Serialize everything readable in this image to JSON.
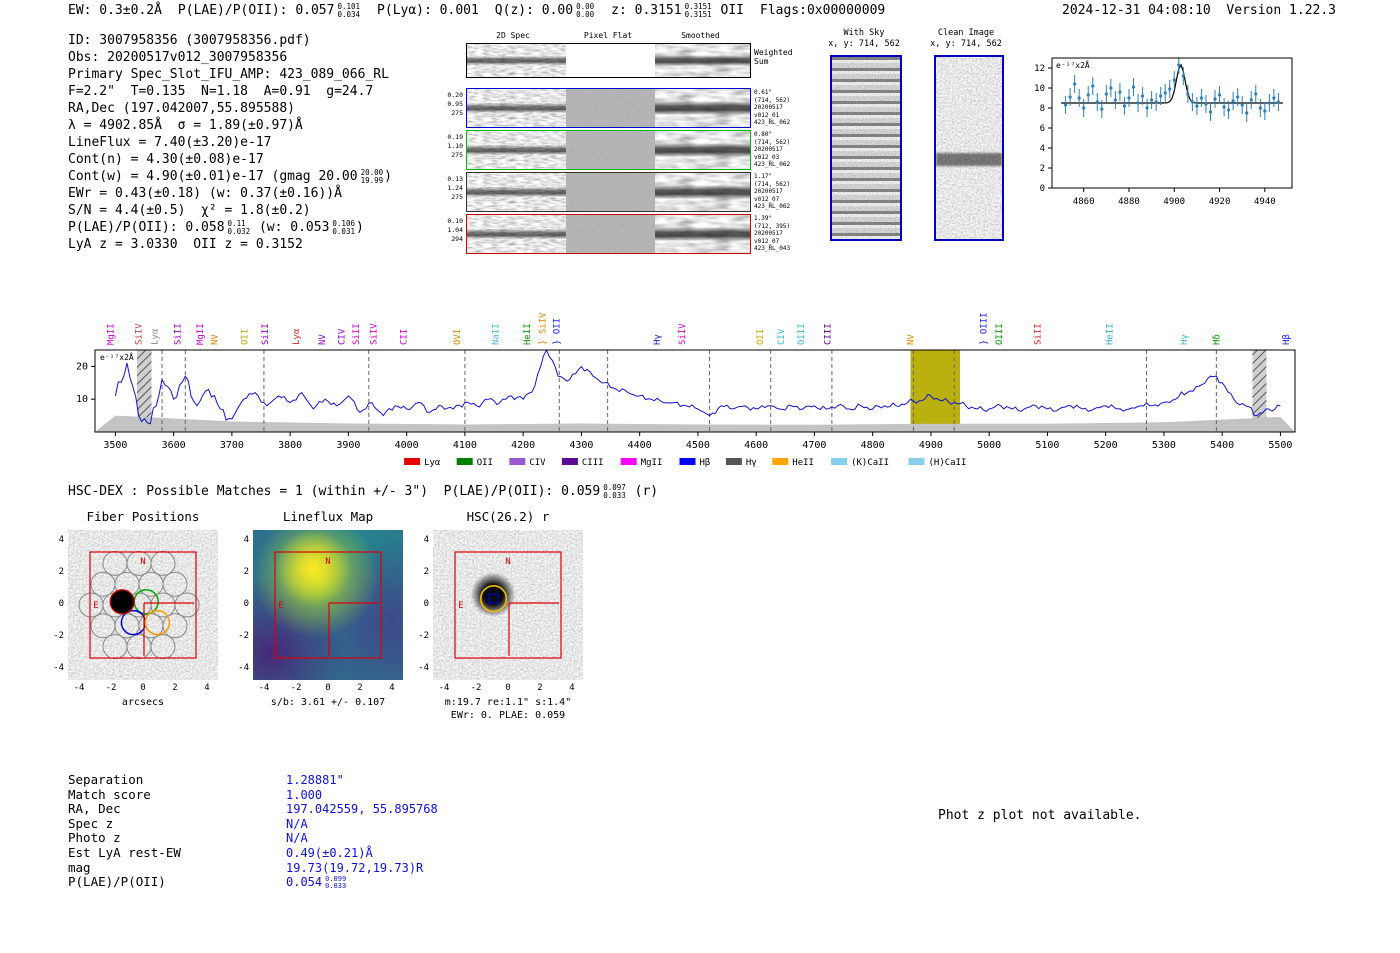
{
  "header": {
    "ew": "EW: 0.3±0.2Å",
    "plae": "P(LAE)/P(OII): 0.057",
    "plae_hi": "0.101",
    "plae_lo": "0.034",
    "plya": "P(Lyα): 0.001",
    "qz": "Q(z): 0.00",
    "qz_hi": "0.00",
    "qz_lo": "0.00",
    "z": "z: 0.3151",
    "z_hi": "0.3151",
    "z_lo": "0.3151",
    "z_type": "OII",
    "flags": "Flags:0x00000009",
    "datetime": "2024-12-31 04:08:10",
    "version": "Version 1.22.3"
  },
  "info": {
    "id": "ID: 3007958356 (3007958356.pdf)",
    "obs": "Obs: 20200517v012_3007958356",
    "primary": "Primary Spec_Slot_IFU_AMP: 423_089_066_RL",
    "seeing": "F=2.2\"  T=0.135  N=1.18  A=0.91  g=24.7",
    "radec": "RA,Dec (197.042007,55.895588)",
    "lambda": "λ = 4902.85Å  σ = 1.89(±0.97)Å",
    "lineflux": "LineFlux = 7.40(±3.20)e-17",
    "cont_n": "Cont(n) = 4.30(±0.08)e-17",
    "cont_w": "Cont(w) = 4.90(±0.01)e-17 (gmag 20.00",
    "cont_w_hi": "20.00",
    "cont_w_lo": "19.99",
    "cont_w_end": ")",
    "ewr": "EWr = 0.43(±0.18) (w: 0.37(±0.16))Å",
    "sn": "S/N = 4.4(±0.5)  χ² = 1.8(±0.2)",
    "plae": "P(LAE)/P(OII): 0.058",
    "plae_hi": "0.11",
    "plae_lo": "0.032",
    "plae_mid": "(w: 0.053",
    "plae_w_hi": "0.106",
    "plae_w_lo": "0.031",
    "plae_end": ")",
    "zline": "LyA z = 3.0330  OII z = 0.3152"
  },
  "spec2d": {
    "col_headers": [
      "2D Spec",
      "Pixel Flat",
      "Smoothed"
    ],
    "weighted_label": [
      "Weighted",
      "Sum"
    ],
    "rows": [
      {
        "vals": [
          "0.20",
          "0.95",
          "275"
        ],
        "ann": [
          "0.61\"",
          "(714, 562)",
          "20200517",
          "v012_01",
          "423_RL_062"
        ],
        "border": "#0000cc"
      },
      {
        "vals": [
          "0.19",
          "1.10",
          "275"
        ],
        "ann": [
          "0.80\"",
          "(714, 562)",
          "20200517",
          "v012_03",
          "423_RL_062"
        ],
        "border": "#00bb00"
      },
      {
        "vals": [
          "0.13",
          "1.24",
          "275"
        ],
        "ann": [
          "1.17\"",
          "(714, 562)",
          "20200517",
          "v012_07",
          "423_RL_062"
        ],
        "border": "#333333"
      },
      {
        "vals": [
          "0.10",
          "1.04",
          "294"
        ],
        "ann": [
          "1.39\"",
          "(712, 395)",
          "20200517",
          "v012_07",
          "423_RL_043"
        ],
        "border": "#cc0000"
      }
    ]
  },
  "sky_cutouts": {
    "withsky_title": "With Sky",
    "withsky_xy": "x, y: 714, 562",
    "clean_title": "Clean Image",
    "clean_xy": "x, y: 714, 562"
  },
  "hsc_line": {
    "text": "HSC-DEX : Possible Matches = 1 (within +/- 3\")  P(LAE)/P(OII): 0.059",
    "hi": "0.097",
    "lo": "0.033",
    "suffix": " (r)"
  },
  "panels": {
    "ticks": [
      "-4",
      "-2",
      "0",
      "2",
      "4"
    ],
    "compass_n": "N",
    "compass_e": "E",
    "fiber": {
      "title": "Fiber Positions",
      "xlabel": "arcsecs",
      "radius_arcsec": 0.75,
      "circles": [
        [
          -1.75,
          2.6
        ],
        [
          -0.25,
          2.6
        ],
        [
          1.25,
          2.6
        ],
        [
          -2.5,
          1.3
        ],
        [
          -1.0,
          1.3
        ],
        [
          0.5,
          1.3
        ],
        [
          2.0,
          1.3
        ],
        [
          -3.25,
          0
        ],
        [
          -1.75,
          0
        ],
        [
          -0.25,
          0
        ],
        [
          1.25,
          0
        ],
        [
          2.75,
          0
        ],
        [
          -2.5,
          -1.3
        ],
        [
          -1.0,
          -1.3
        ],
        [
          0.5,
          -1.3
        ],
        [
          2.0,
          -1.3
        ],
        [
          -1.75,
          -2.6
        ],
        [
          -0.25,
          -2.6
        ],
        [
          1.25,
          -2.6
        ]
      ],
      "black_fiber": [
        -1.3,
        0.2
      ],
      "green_fiber": [
        0.2,
        0.2
      ],
      "blue_fiber": [
        -0.6,
        -1.1
      ],
      "orange_fiber": [
        0.9,
        -1.1
      ]
    },
    "lineflux": {
      "title": "Lineflux Map",
      "caption": "s/b: 3.61 +/- 0.107"
    },
    "hsc": {
      "title": "HSC(26.2) r",
      "caption1": "m:19.7 re:1.1\" s:1.4\"",
      "caption2": "EWr: 0. PLAE: 0.059",
      "ring": [
        -0.9,
        0.4,
        0.8
      ],
      "square": [
        -0.9,
        0.4,
        0.55
      ]
    }
  },
  "match_table": {
    "rows": [
      {
        "label": "Separation",
        "value": "1.28881\""
      },
      {
        "label": "Match score",
        "value": "1.000"
      },
      {
        "label": "RA, Dec",
        "value": "197.042559, 55.895768"
      },
      {
        "label": "Spec z",
        "value": "N/A"
      },
      {
        "label": "Photo z",
        "value": "N/A"
      },
      {
        "label": "Est LyA rest-EW",
        "value": "0.49(±0.21)Å"
      },
      {
        "label": "mag",
        "value": "19.73(19.72,19.73)R"
      },
      {
        "label": "P(LAE)/P(OII)",
        "value": "0.054",
        "hi": "0.099",
        "lo": "0.033"
      }
    ]
  },
  "photz_note": "Phot z plot not available.",
  "chart_data": [
    {
      "type": "scatter",
      "title": "Line fit inset",
      "unit_label": "e⁻¹⁷x2Å",
      "x_start": 4852,
      "x_step": 2,
      "y": [
        8.3,
        9.1,
        10.4,
        9.0,
        8.0,
        9.3,
        10.2,
        8.6,
        7.9,
        9.4,
        10.0,
        8.8,
        9.6,
        8.2,
        9.0,
        10.1,
        8.5,
        9.2,
        8.0,
        8.8,
        8.6,
        9.2,
        9.5,
        9.9,
        10.8,
        12.3,
        11.2,
        9.4,
        8.6,
        8.2,
        9.0,
        8.4,
        7.6,
        8.9,
        9.3,
        8.1,
        7.8,
        8.7,
        9.1,
        8.3,
        7.5,
        8.8,
        9.4,
        8.0,
        7.7,
        8.5,
        9.0,
        8.6
      ],
      "yerr": 0.9,
      "fit": {
        "baseline": 8.5,
        "amplitude": 3.8,
        "center": 4902.85,
        "sigma": 1.89
      },
      "xlim": [
        4846,
        4952
      ],
      "ylim": [
        0,
        13
      ],
      "xticks": [
        4860,
        4880,
        4900,
        4920,
        4940
      ],
      "yticks": [
        0,
        2,
        4,
        6,
        8,
        10,
        12
      ],
      "point_color": "#2c7fb8",
      "fit_color": "#000000"
    },
    {
      "type": "line",
      "title": "Full HETDEX spectrum",
      "unit_label": "e⁻¹⁷x2Å",
      "x_start": 3500,
      "x_step": 20,
      "flux": [
        11,
        21,
        5,
        2.5,
        16,
        10,
        17,
        8,
        13,
        7,
        4,
        10,
        12,
        8,
        11,
        9,
        12,
        7,
        10,
        8,
        11,
        6,
        9,
        5,
        8,
        7,
        9,
        6,
        8,
        7,
        9,
        8,
        10,
        9,
        11,
        10,
        14,
        26,
        17,
        16,
        20,
        17,
        15,
        13,
        12,
        11,
        10,
        9,
        9,
        8,
        7,
        5,
        8,
        7,
        8,
        7,
        8,
        7,
        8,
        7,
        8,
        7,
        8,
        7,
        8,
        7,
        8,
        8,
        9,
        9.5,
        11,
        9.5,
        9,
        8,
        7,
        7,
        8,
        7,
        7,
        8,
        7,
        7,
        8,
        7,
        7,
        8,
        7,
        7,
        8,
        8,
        9,
        10,
        12,
        14,
        17,
        15,
        10,
        8,
        5,
        7,
        8
      ],
      "noise_x": [
        3500,
        3700,
        3900,
        4100,
        4300,
        4500,
        4700,
        4900,
        5100,
        5300,
        5500
      ],
      "noise_y": [
        5,
        3.2,
        2.6,
        2.3,
        2.6,
        2.3,
        2.2,
        2.5,
        2.5,
        3.0,
        4.6
      ],
      "xlim": [
        3465,
        5525
      ],
      "ylim": [
        0,
        25
      ],
      "xticks": [
        3500,
        3600,
        3700,
        3800,
        3900,
        4000,
        4100,
        4200,
        4300,
        4400,
        4500,
        4600,
        4700,
        4800,
        4900,
        5000,
        5100,
        5200,
        5300,
        5400,
        5500
      ],
      "yticks": [
        10,
        20
      ],
      "line_color": "#1414cc",
      "noise_color": "#c3c3c3",
      "highlight_band": {
        "x0": 4865,
        "x1": 4950,
        "color": "#b5ab00"
      },
      "hatch_bands": [
        {
          "x0": 3537,
          "x1": 3562
        },
        {
          "x0": 5452,
          "x1": 5476
        }
      ],
      "dashed_lines": [
        3580,
        3620,
        3755,
        3935,
        4100,
        4262,
        4345,
        4520,
        4625,
        4730,
        4870,
        4940,
        5270,
        5390
      ],
      "emission_labels": [
        {
          "wave": 3497,
          "label": "MgII",
          "color": "#cc00cc"
        },
        {
          "wave": 3545,
          "label": "SiIV",
          "color": "#bb4444"
        },
        {
          "wave": 3572,
          "label": "Lyα",
          "color": "#888888"
        },
        {
          "wave": 3612,
          "label": "SiII",
          "color": "#9900cc"
        },
        {
          "wave": 3650,
          "label": "MgII",
          "color": "#cc00cc"
        },
        {
          "wave": 3675,
          "label": "NV",
          "color": "#cc8800"
        },
        {
          "wave": 3727,
          "label": "OII",
          "color": "#ccaa00"
        },
        {
          "wave": 3762,
          "label": "SiII",
          "color": "#9900cc"
        },
        {
          "wave": 3815,
          "label": "Lyα",
          "color": "#dd2222"
        },
        {
          "wave": 3860,
          "label": "NV",
          "color": "#9900cc"
        },
        {
          "wave": 3893,
          "label": "CIV",
          "color": "#9900cc"
        },
        {
          "wave": 3918,
          "label": "SiII",
          "color": "#cc00cc"
        },
        {
          "wave": 3948,
          "label": "SiIV",
          "color": "#cc00cc"
        },
        {
          "wave": 4000,
          "label": "CII",
          "color": "#cc00cc"
        },
        {
          "wave": 4092,
          "label": "OVI",
          "color": "#dd8800"
        },
        {
          "wave": 4158,
          "label": "NaII",
          "color": "#44bbcc"
        },
        {
          "wave": 4212,
          "label": "HeII",
          "color": "#009900"
        },
        {
          "wave": 4238,
          "label": "} SiIV",
          "color": "#dd8800"
        },
        {
          "wave": 4262,
          "label": "} OII",
          "color": "#2222ee"
        },
        {
          "wave": 4435,
          "label": "Hγ",
          "color": "#2222cc"
        },
        {
          "wave": 4478,
          "label": "SiIV",
          "color": "#cc00cc"
        },
        {
          "wave": 4612,
          "label": "OII",
          "color": "#ccaa00"
        },
        {
          "wave": 4648,
          "label": "CIV",
          "color": "#33bbcc"
        },
        {
          "wave": 4682,
          "label": "OIII",
          "color": "#33bbcc"
        },
        {
          "wave": 4728,
          "label": "CIII",
          "color": "#660099"
        },
        {
          "wave": 4870,
          "label": "NV",
          "color": "#dd8800"
        },
        {
          "wave": 4995,
          "label": "} OIII",
          "color": "#2222ee"
        },
        {
          "wave": 5022,
          "label": "OIII",
          "color": "#009900"
        },
        {
          "wave": 5088,
          "label": "SiII",
          "color": "#dd2222"
        },
        {
          "wave": 5212,
          "label": "HeII",
          "color": "#33aacc"
        },
        {
          "wave": 5340,
          "label": "Hγ",
          "color": "#44bbcc"
        },
        {
          "wave": 5395,
          "label": "Hδ",
          "color": "#009900"
        },
        {
          "wave": 5515,
          "label": "Hβ",
          "color": "#2222ee"
        }
      ],
      "legend": [
        {
          "label": "Lyα",
          "color": "#e60000"
        },
        {
          "label": "OII",
          "color": "#008000"
        },
        {
          "label": "CIV",
          "color": "#9b59d0"
        },
        {
          "label": "CIII",
          "color": "#5b0a91"
        },
        {
          "label": "MgII",
          "color": "#ff00ff"
        },
        {
          "label": "Hβ",
          "color": "#0000ff"
        },
        {
          "label": "Hγ",
          "color": "#555555"
        },
        {
          "label": "HeII",
          "color": "#ffa500"
        },
        {
          "label": "(K)CaII",
          "color": "#87ceeb"
        },
        {
          "label": "(H)CaII",
          "color": "#87ceeb"
        }
      ]
    }
  ]
}
